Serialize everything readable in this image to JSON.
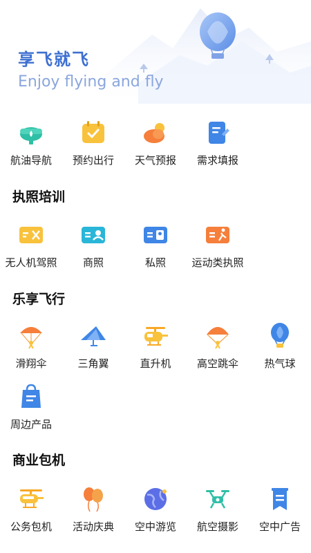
{
  "hero": {
    "title": "享飞就飞",
    "subtitle": "Enjoy flying and fly"
  },
  "quick_actions": [
    {
      "label": "航油导航",
      "icon": "fuel-drop-icon"
    },
    {
      "label": "预约出行",
      "icon": "calendar-check-icon"
    },
    {
      "label": "天气预报",
      "icon": "weather-sun-cloud-icon"
    },
    {
      "label": "需求填报",
      "icon": "form-edit-icon"
    }
  ],
  "sections": [
    {
      "title": "执照培训",
      "items": [
        {
          "label": "无人机驾照",
          "icon": "drone-license-icon"
        },
        {
          "label": "商照",
          "icon": "commercial-license-icon"
        },
        {
          "label": "私照",
          "icon": "private-license-icon"
        },
        {
          "label": "运动类执照",
          "icon": "sport-license-icon"
        }
      ]
    },
    {
      "title": "乐享飞行",
      "items": [
        {
          "label": "滑翔伞",
          "icon": "paraglider-icon"
        },
        {
          "label": "三角翼",
          "icon": "hang-glider-icon"
        },
        {
          "label": "直升机",
          "icon": "helicopter-icon"
        },
        {
          "label": "高空跳伞",
          "icon": "skydiving-icon"
        },
        {
          "label": "热气球",
          "icon": "hot-air-balloon-icon"
        },
        {
          "label": "周边产品",
          "icon": "shopping-bag-icon"
        }
      ]
    },
    {
      "title": "商业包机",
      "items": [
        {
          "label": "公务包机",
          "icon": "business-helicopter-icon"
        },
        {
          "label": "活动庆典",
          "icon": "balloons-icon"
        },
        {
          "label": "空中游览",
          "icon": "globe-icon"
        },
        {
          "label": "航空摄影",
          "icon": "camera-drone-icon"
        },
        {
          "label": "空中广告",
          "icon": "banner-ad-icon"
        }
      ]
    }
  ],
  "colors": {
    "accent": "#3d6fd1",
    "orange": "#f5a34a",
    "teal": "#2fbfa6",
    "blue": "#3f86e6",
    "yellow": "#f9c23c"
  }
}
